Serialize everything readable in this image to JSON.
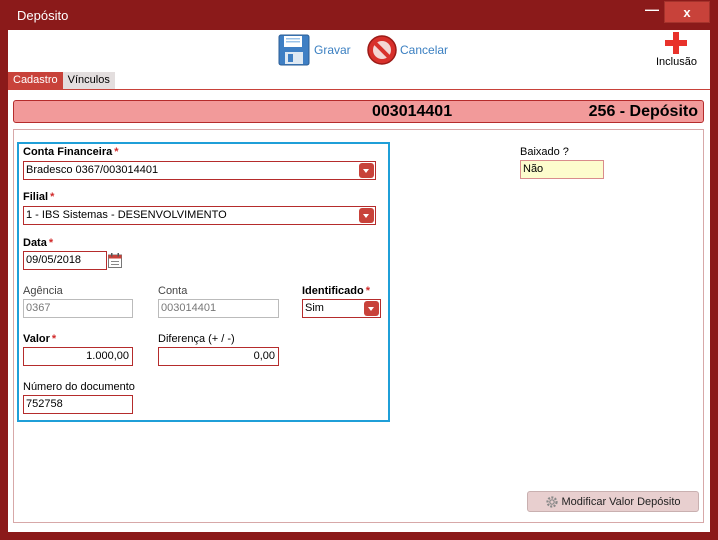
{
  "window": {
    "title": "Depósito",
    "minimize": "—",
    "close": "x"
  },
  "toolbar": {
    "save_label": "Gravar",
    "cancel_label": "Cancelar",
    "new_label": "Inclusão"
  },
  "tabs": [
    {
      "label": "Cadastro",
      "active": true
    },
    {
      "label": "Vínculos",
      "active": false
    }
  ],
  "header": {
    "code": "003014401",
    "type": "256 - Depósito"
  },
  "form": {
    "conta_financeira": {
      "label": "Conta Financeira",
      "required": "*",
      "value": "Bradesco 0367/003014401"
    },
    "filial": {
      "label": "Filial",
      "required": "*",
      "value": "1 - IBS Sistemas - DESENVOLVIMENTO"
    },
    "data": {
      "label": "Data",
      "required": "*",
      "value": "09/05/2018"
    },
    "agencia": {
      "label": "Agência",
      "value": "0367"
    },
    "conta": {
      "label": "Conta",
      "value": "003014401"
    },
    "identificado": {
      "label": "Identificado",
      "required": "*",
      "value": "Sim"
    },
    "valor": {
      "label": "Valor",
      "required": "*",
      "value": "1.000,00"
    },
    "diferenca": {
      "label": "Diferença (+ / -)",
      "value": "0,00"
    },
    "numero_documento": {
      "label": "Número do documento",
      "value": "752758"
    },
    "baixado": {
      "label": "Baixado ?",
      "value": "Não"
    }
  },
  "actions": {
    "modify_label": "Modificar Valor Depósito"
  },
  "colors": {
    "brand": "#8b1a1a",
    "accent": "#c8423a",
    "header_bg": "#f29a9a",
    "focus": "#1f9fd8",
    "link": "#3a7fc1"
  }
}
